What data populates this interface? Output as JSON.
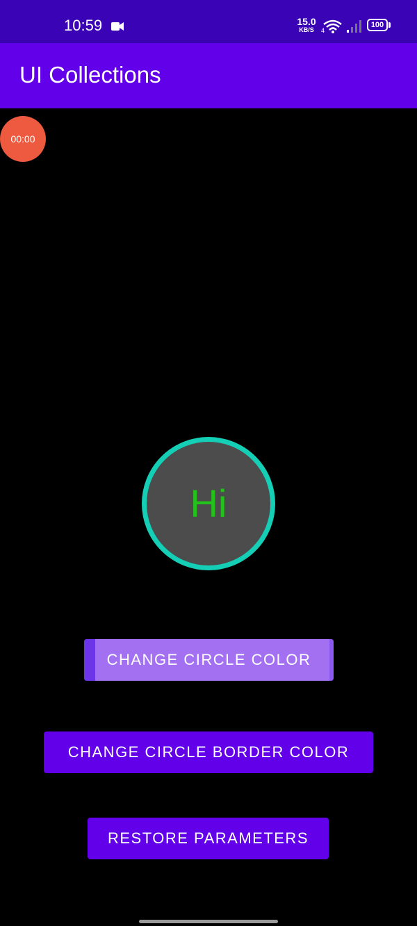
{
  "status_bar": {
    "time": "10:59",
    "net_speed_value": "15.0",
    "net_speed_unit": "KB/S",
    "wifi_badge": "4",
    "battery_level": "100"
  },
  "app_bar": {
    "title": "UI Collections"
  },
  "recording_badge": {
    "timer": "00:00"
  },
  "circle": {
    "text": "Hi",
    "fill_color": "#4c4c4c",
    "border_color": "#15ceb6",
    "text_color": "#23c21a"
  },
  "buttons": {
    "change_color": "CHANGE CIRCLE COLOR",
    "change_border_color": "CHANGE CIRCLE BORDER COLOR",
    "restore": "RESTORE PARAMETERS"
  },
  "colors": {
    "status_bar": "#3a04b6",
    "app_bar": "#6200ea",
    "button": "#6200ea",
    "button_pressed": "#a270f0",
    "record_badge": "#ee5a3f"
  }
}
